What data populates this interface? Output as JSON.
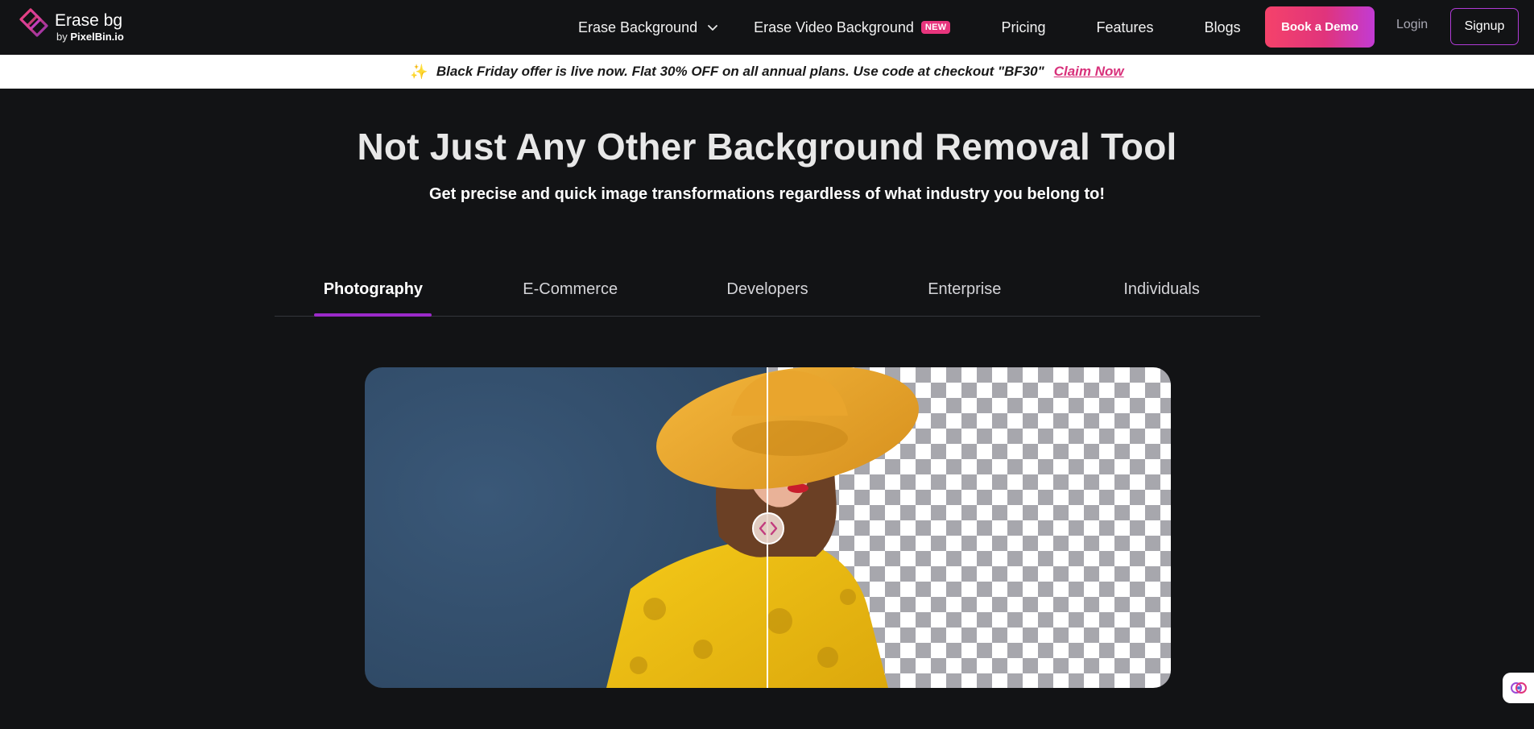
{
  "colors": {
    "background": "#121315",
    "accent_pink": "#e0347c",
    "accent_purple": "#9b2ac9",
    "promo_bg": "#ffffff"
  },
  "header": {
    "logo_title": "Erase bg",
    "logo_by": "by",
    "logo_brand": "PixelBin.io",
    "nav": [
      {
        "label": "Erase Background",
        "icon": "chevron-down-icon"
      },
      {
        "label": "Erase Video Background",
        "badge": "NEW"
      },
      {
        "label": "Pricing"
      },
      {
        "label": "Features"
      },
      {
        "label": "Blogs"
      }
    ],
    "book_demo": "Book a Demo",
    "login": "Login",
    "signup": "Signup"
  },
  "promo": {
    "icon": "sparkle-icon",
    "text": "Black Friday offer is live now. Flat 30% OFF on all annual plans. Use code at checkout \"BF30\"",
    "cta": "Claim Now"
  },
  "hero": {
    "title": "Not Just Any Other Background Removal Tool",
    "subtitle": "Get precise and quick image transformations regardless of what industry you belong to!"
  },
  "tabs": [
    {
      "label": "Photography",
      "active": true
    },
    {
      "label": "E-Commerce",
      "active": false
    },
    {
      "label": "Developers",
      "active": false
    },
    {
      "label": "Enterprise",
      "active": false
    },
    {
      "label": "Individuals",
      "active": false
    }
  ],
  "compare": {
    "slider_position": 0.5,
    "handle_icon": "left-right-arrows-icon"
  },
  "widget": {
    "icon": "brain-icon"
  }
}
